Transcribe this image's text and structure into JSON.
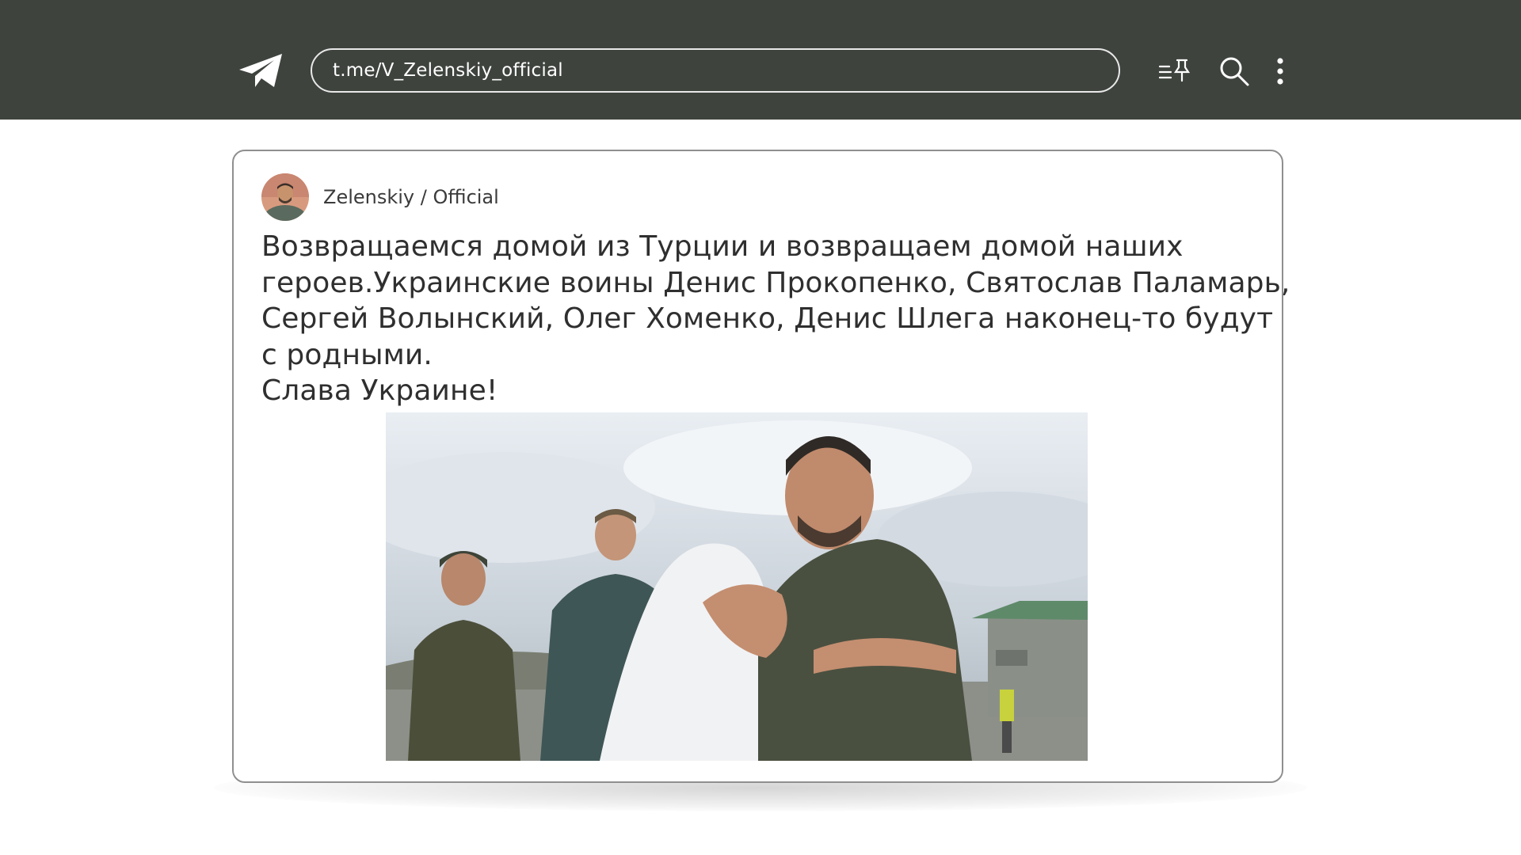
{
  "topbar": {
    "url": "t.me/V_Zelenskiy_official",
    "icons": [
      "telegram-logo",
      "pinned-list-icon",
      "search-icon",
      "more-vertical-icon"
    ]
  },
  "post": {
    "channel_name": "Zelenskiy / Official",
    "text_lines": [
      "Возвращаемся домой из Турции и возвращаем домой наших",
      "героев.Украинские воины Денис Прокопенко, Святослав Паламарь,",
      "Сергей Волынский, Олег Хоменко, Денис Шлега наконец-то будут",
      "с родными.",
      "Слава Украине!"
    ]
  },
  "colors": {
    "topbar_bg": "#3e433e",
    "card_border": "#8f8f8f",
    "text": "#2f2f2f"
  }
}
